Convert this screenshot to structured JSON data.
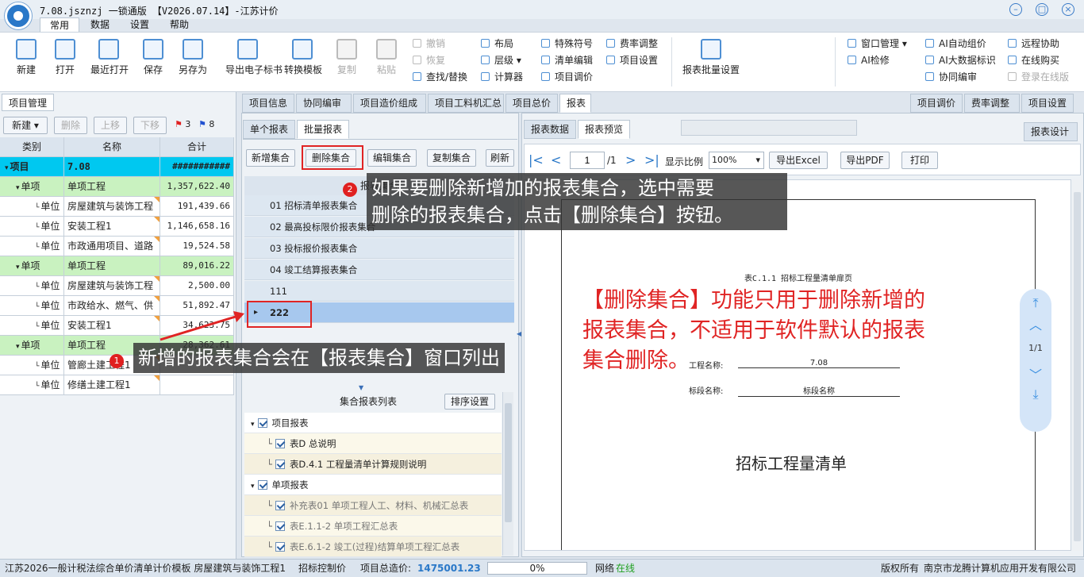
{
  "app": {
    "title": "7.08.jsznzj 一锁通版 【V2026.07.14】-江苏计价",
    "menu_tabs": [
      "常用",
      "数据",
      "设置",
      "帮助"
    ],
    "active_menu": "常用"
  },
  "ribbon": {
    "big": {
      "new": "新建",
      "open": "打开",
      "recent": "最近打开",
      "save": "保存",
      "saveas": "另存为",
      "export_bid": "导出电子标书",
      "convert": "转换模板",
      "copy": "复制",
      "paste": "粘贴",
      "report_batch": "报表批量设置"
    },
    "small": {
      "undo": "撤销",
      "redo": "恢复",
      "find": "查找/替换",
      "layout": "布局",
      "level": "层级",
      "calc": "计算器",
      "symbol": "特殊符号",
      "list_edit": "清单编辑",
      "project_price": "项目调价",
      "fee_adjust": "费率调整",
      "project_settings": "项目设置",
      "window_mgmt": "窗口管理",
      "ai_check": "AI检修",
      "ai_price": "AI自动组价",
      "ai_data": "AI大数据标识",
      "collab_edit": "协同编审",
      "remote": "远程协助",
      "buy_online": "在线购买",
      "login_online": "登录在线版"
    }
  },
  "project_panel": {
    "header": "项目管理",
    "tools": {
      "new": "新建",
      "delete": "删除",
      "up": "上移",
      "down": "下移",
      "red_count": "3",
      "blue_count": "8"
    },
    "columns": [
      "类别",
      "名称",
      "合计"
    ],
    "rows": [
      {
        "type": "项目",
        "name": "7.08",
        "total": "###########",
        "level": 0
      },
      {
        "type": "单项",
        "name": "单项工程",
        "total": "1,357,622.40",
        "level": 1
      },
      {
        "type": "单位",
        "name": "房屋建筑与装饰工程",
        "total": "191,439.66",
        "level": 2
      },
      {
        "type": "单位",
        "name": "安装工程1",
        "total": "1,146,658.16",
        "level": 2
      },
      {
        "type": "单位",
        "name": "市政通用项目、道路",
        "total": "19,524.58",
        "level": 2
      },
      {
        "type": "单项",
        "name": "单项工程",
        "total": "89,016.22",
        "level": 1
      },
      {
        "type": "单位",
        "name": "房屋建筑与装饰工程",
        "total": "2,500.00",
        "level": 2
      },
      {
        "type": "单位",
        "name": "市政给水、燃气、供",
        "total": "51,892.47",
        "level": 2
      },
      {
        "type": "单位",
        "name": "安装工程1",
        "total": "34,623.75",
        "level": 2
      },
      {
        "type": "单项",
        "name": "单项工程",
        "total": "28,362.61",
        "level": 1
      },
      {
        "type": "单位",
        "name": "管廊土建工程1",
        "total": "",
        "level": 2
      },
      {
        "type": "单位",
        "name": "修缮土建工程1",
        "total": "",
        "level": 2
      }
    ]
  },
  "main_tabs": [
    "项目信息",
    "协同编审",
    "项目造价组成",
    "项目工料机汇总",
    "项目总价",
    "报表"
  ],
  "right_tabs": [
    "项目调价",
    "费率调整",
    "项目设置"
  ],
  "report_panel": {
    "subtabs": [
      "单个报表",
      "批量报表"
    ],
    "buttons": {
      "add": "新增集合",
      "delete": "删除集合",
      "edit": "编辑集合",
      "copy": "复制集合",
      "refresh": "刷新"
    },
    "list_header": "报表集合",
    "sets": [
      "01 招标清单报表集合",
      "02 最高投标限价报表集合",
      "03 投标报价报表集合",
      "04 竣工结算报表集合",
      "111",
      "222"
    ],
    "selected_set": "222",
    "set_list_title": "集合报表列表",
    "sort_button": "排序设置",
    "set_reports": [
      {
        "label": "项目报表",
        "group": true
      },
      {
        "label": "表D 总说明",
        "group": false
      },
      {
        "label": "表D.4.1 工程量清单计算规则说明",
        "group": false
      },
      {
        "label": "单项报表",
        "group": true
      },
      {
        "label": "补充表01 单项工程人工、材料、机械汇总表",
        "group": false
      },
      {
        "label": "表E.1.1-2 单项工程汇总表",
        "group": false
      },
      {
        "label": "表E.6.1-2 竣工(过程)结算单项工程汇总表",
        "group": false
      }
    ]
  },
  "preview": {
    "tabs": [
      "报表数据",
      "报表预览"
    ],
    "design_button": "报表设计",
    "page_input": "1",
    "page_total": "/1",
    "zoom_label": "显示比例",
    "zoom_value": "100%",
    "export_excel": "导出Excel",
    "export_pdf": "导出PDF",
    "print": "打印",
    "page_header": "表C.1.1 招标工程量清单扉页",
    "project_name_label": "工程名称:",
    "project_name_value": "7.08",
    "section_name_label": "标段名称:",
    "section_name_value": "标段名称",
    "doc_title": "招标工程量清单",
    "page_indicator": "1/1"
  },
  "annotations": {
    "callout1": "新增的报表集合会在【报表集合】窗口列出",
    "callout2_line1": "如果要删除新增加的报表集合，选中需要",
    "callout2_line2": "删除的报表集合，点击【删除集合】按钮。",
    "note_line1": "【删除集合】功能只用于删除新增的",
    "note_line2": "报表集合，不适用于软件默认的报表",
    "note_line3": "集合删除。",
    "badge1": "1",
    "badge2": "2"
  },
  "status": {
    "template": "江苏2026一般计税法综合单价清单计价模板 房屋建筑与装饰工程1",
    "control": "招标控制价",
    "total_label": "项目总造价:",
    "total_value": "1475001.23",
    "progress": "0%",
    "network_label": "网络",
    "network_status": "在线",
    "copyright": "版权所有",
    "company": "南京市龙腾计算机应用开发有限公司"
  },
  "colors": {
    "accent": "#2a78c8",
    "project_row": "#00c8f0",
    "single_row": "#c9f2c0",
    "selected_set": "#a7c8ee",
    "red": "#e02424",
    "green": "#20a020"
  }
}
